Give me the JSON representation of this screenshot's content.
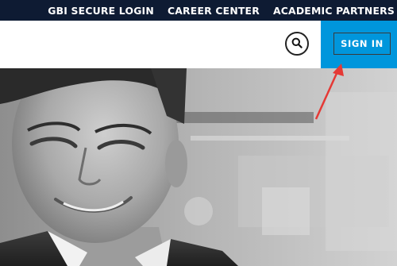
{
  "top_nav": {
    "items": [
      {
        "label": "GBI SECURE LOGIN"
      },
      {
        "label": "CAREER CENTER"
      },
      {
        "label": "ACADEMIC PARTNERS"
      }
    ]
  },
  "header": {
    "search_icon": "search-icon",
    "sign_in_label": "SIGN IN"
  },
  "colors": {
    "top_bar": "#0e1b33",
    "sign_in_panel": "#0096dc",
    "annotation_arrow": "#e53935"
  }
}
